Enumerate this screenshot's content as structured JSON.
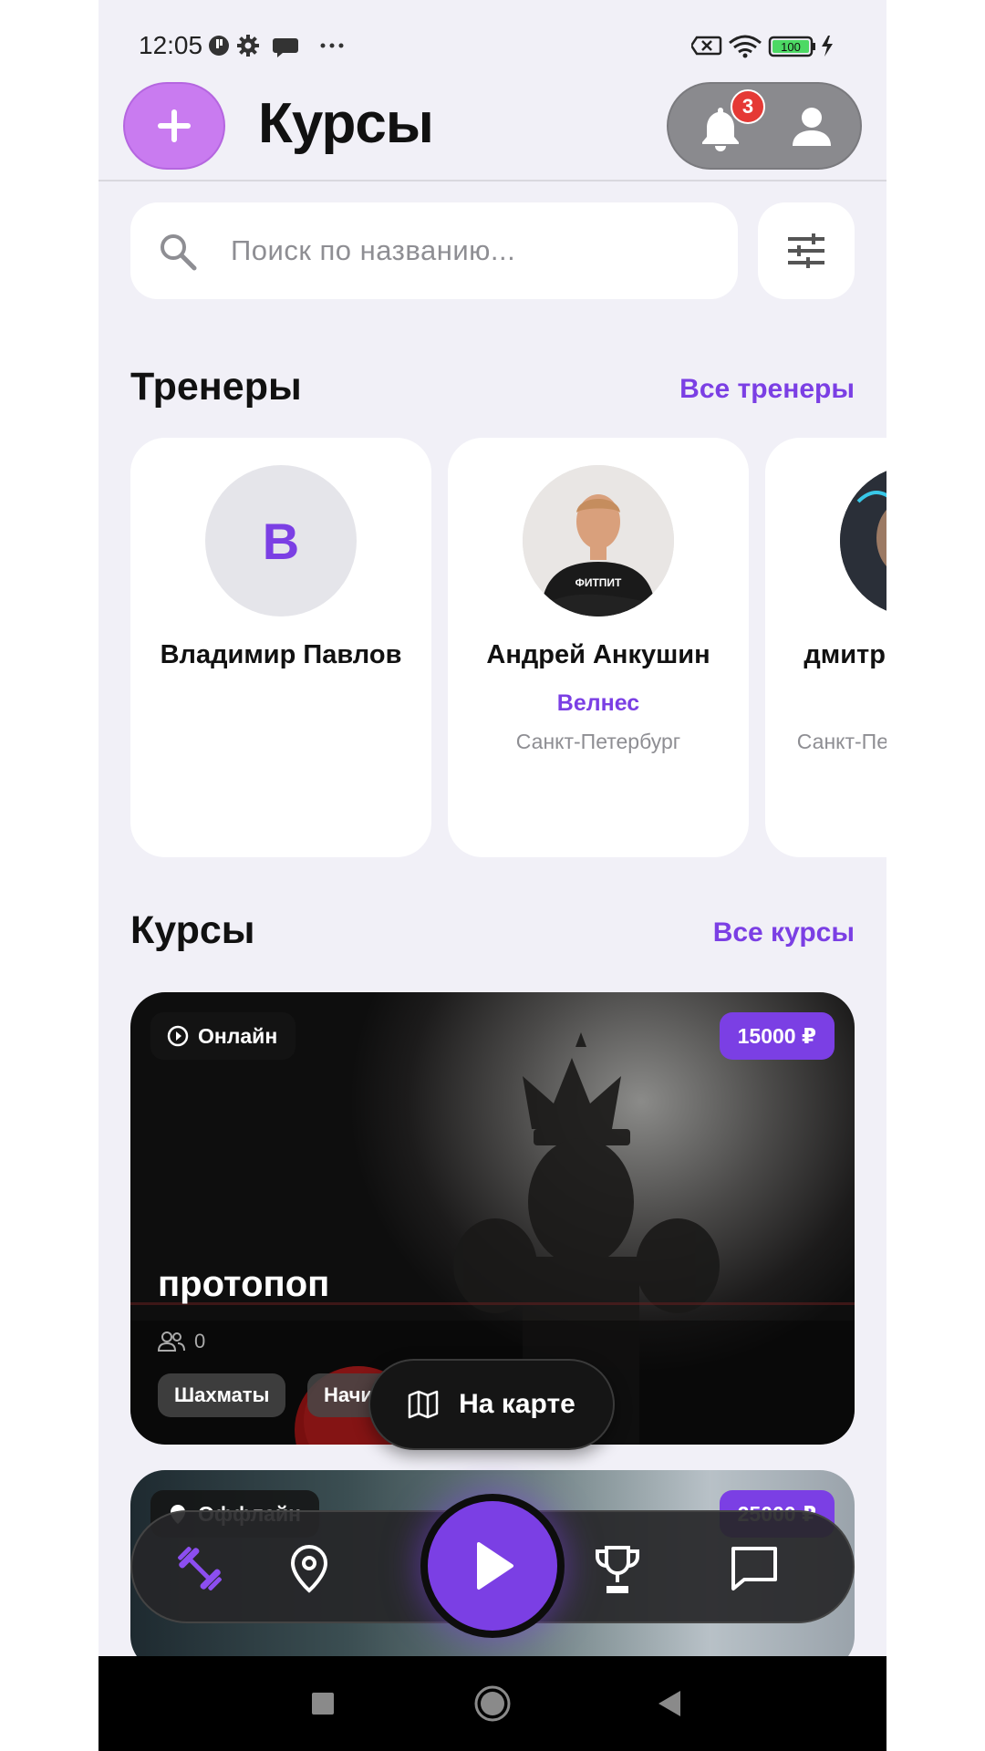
{
  "status_bar": {
    "time": "12:05",
    "battery": "100"
  },
  "header": {
    "title": "Курсы",
    "notifications_count": "3"
  },
  "search": {
    "placeholder": "Поиск по названию..."
  },
  "trainers_section": {
    "title": "Тренеры",
    "link": "Все тренеры",
    "items": [
      {
        "initial": "В",
        "name": "Владимир Павлов",
        "category": "",
        "city": ""
      },
      {
        "initial": "",
        "name": "Андрей Анкушин",
        "category": "Велнес",
        "city": "Санкт-Петербург",
        "shirt_text": "ФИТПИТ"
      },
      {
        "initial": "",
        "name": "дмитрий",
        "category": "",
        "city": "Санкт-Петербург"
      }
    ]
  },
  "courses_section": {
    "title": "Курсы",
    "link": "Все курсы",
    "items": [
      {
        "format": "Онлайн",
        "price": "15000 ₽",
        "name": "протопоп",
        "participants": "0",
        "tags": [
          "Шахматы",
          "Начинающий"
        ]
      },
      {
        "format": "Оффлайн",
        "price": "25000 ₽"
      }
    ]
  },
  "map_button": {
    "label": "На карте"
  },
  "bottom_nav": {
    "items": [
      "dumbbell-icon",
      "location-pin-icon",
      "play-icon",
      "trophy-icon",
      "chat-icon"
    ]
  },
  "colors": {
    "accent": "#7b3fe4",
    "add_button": "#c97bf0",
    "background": "#f1f0f7"
  }
}
